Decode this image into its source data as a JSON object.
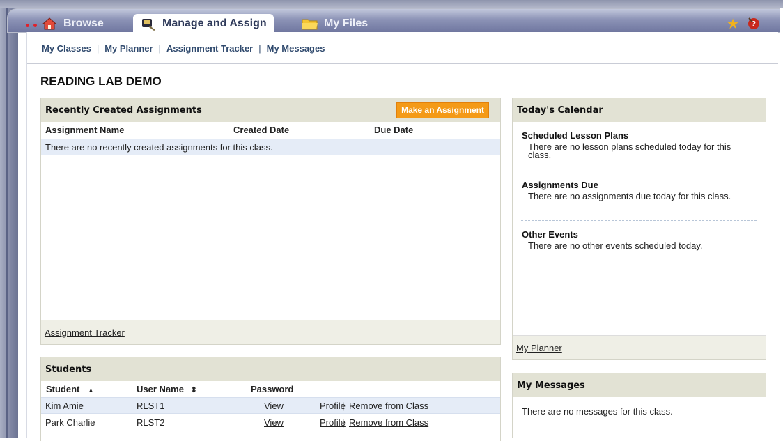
{
  "tabs": {
    "browse": "Browse",
    "manage": "Manage and Assign",
    "files": "My Files"
  },
  "subnav": [
    "My Classes",
    "My Planner",
    "Assignment Tracker",
    "My Messages"
  ],
  "class_title": "READING LAB DEMO",
  "recent": {
    "title": "Recently Created Assignments",
    "make_button": "Make an Assignment",
    "col_name": "Assignment Name",
    "col_created": "Created Date",
    "col_due": "Due Date",
    "empty": "There are no recently created assignments for this class.",
    "footer_link": "Assignment Tracker"
  },
  "students": {
    "title": "Students",
    "col_student": "Student",
    "col_username": "User Name",
    "col_password": "Password",
    "sort_asc": "▲",
    "sort_both": "⬍",
    "rows": [
      {
        "name": "Kim Amie",
        "user": "RLST1",
        "view": "View",
        "profile": "Profile",
        "sep": "|",
        "remove": "Remove from Class"
      },
      {
        "name": "Park Charlie",
        "user": "RLST2",
        "view": "View",
        "profile": "Profile",
        "sep": "|",
        "remove": "Remove from Class"
      }
    ]
  },
  "calendar": {
    "title": "Today's Calendar",
    "lesson_title": "Scheduled Lesson Plans",
    "lesson_text": "There are no lesson plans scheduled today for this class.",
    "due_title": "Assignments Due",
    "due_text": "There are no assignments due today for this class.",
    "other_title": "Other Events",
    "other_text": "There are no other events scheduled today.",
    "footer_link": "My Planner"
  },
  "messages": {
    "title": "My Messages",
    "empty": "There are no messages for this class."
  },
  "colors": {
    "accent_orange": "#f49a17",
    "panel_header": "#e2e2d4",
    "row_highlight": "#e5ecf7",
    "tabbar": "#7077a0"
  }
}
